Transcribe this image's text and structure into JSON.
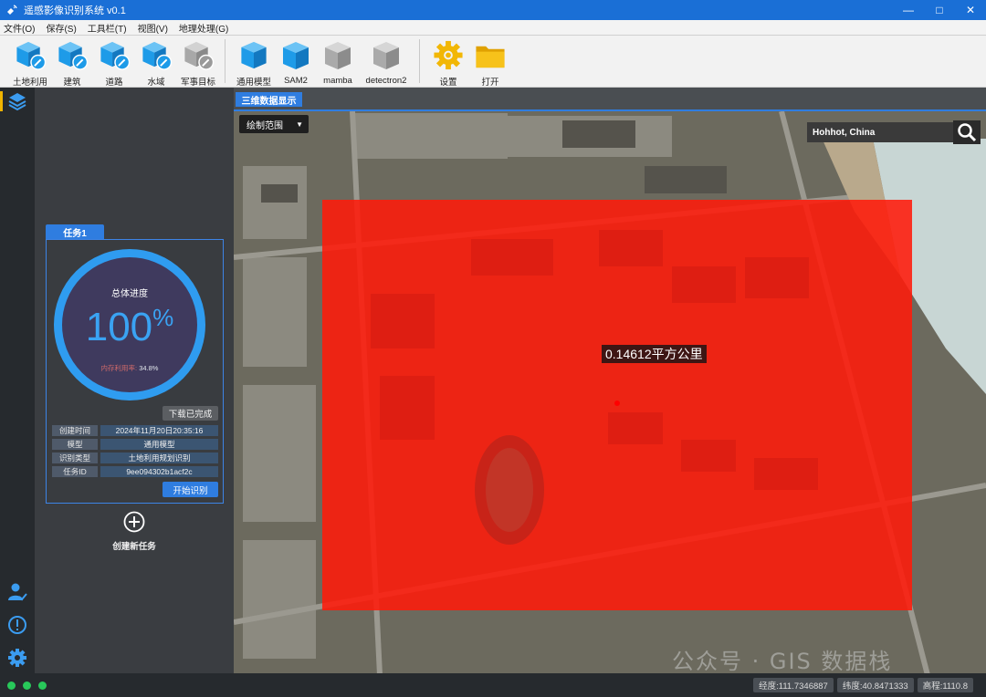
{
  "window": {
    "title": "遥感影像识别系统 v0.1",
    "app_icon": "satellite-icon",
    "controls": [
      "minimize-icon",
      "maximize-icon",
      "close-icon"
    ]
  },
  "menu": [
    "文件(O)",
    "保存(S)",
    "工具栏(T)",
    "视图(V)",
    "地理处理(G)"
  ],
  "toolbar": {
    "group1": [
      {
        "label": "土地利用",
        "icon": "cube-edit-icon",
        "color": "#1e9be8"
      },
      {
        "label": "建筑",
        "icon": "cube-edit-icon",
        "color": "#1e9be8"
      },
      {
        "label": "道路",
        "icon": "cube-edit-icon",
        "color": "#1e9be8"
      },
      {
        "label": "水域",
        "icon": "cube-edit-icon",
        "color": "#1e9be8"
      },
      {
        "label": "军事目标",
        "icon": "cube-edit-icon",
        "color": "#9a9a9a"
      }
    ],
    "group2": [
      {
        "label": "通用模型",
        "icon": "cube-icon",
        "color": "#1e9be8"
      },
      {
        "label": "SAM2",
        "icon": "cube-icon",
        "color": "#1e9be8"
      },
      {
        "label": "mamba",
        "icon": "cube-icon",
        "color": "#9a9a9a"
      },
      {
        "label": "detectron2",
        "icon": "cube-icon",
        "color": "#9a9a9a"
      }
    ],
    "group3": [
      {
        "label": "设置",
        "icon": "gear-icon",
        "color": "#f2b705"
      },
      {
        "label": "打开",
        "icon": "folder-icon",
        "color": "#f2b705"
      }
    ]
  },
  "task": {
    "tab_label": "任务1",
    "progress_title": "总体进度",
    "progress_value": "100",
    "progress_unit": "%",
    "memory_label": "内存利用率:",
    "memory_value": "34.8%",
    "download_button": "下载已完成",
    "info": [
      {
        "key": "创建时间",
        "value": "2024年11月20日20:35:16"
      },
      {
        "key": "模型",
        "value": "通用模型"
      },
      {
        "key": "识别类型",
        "value": "土地利用规划识别"
      },
      {
        "key": "任务ID",
        "value": "9ee094302b1acf2c"
      }
    ],
    "start_button": "开始识别",
    "new_task": "创建新任务"
  },
  "map": {
    "tab_label": "三维数据显示",
    "draw_select": "绘制范围",
    "search_value": "Hohhot, China",
    "area_label": "0.14612平方公里",
    "overlay_color": "#ff1a0a",
    "watermark": "公众号 · GIS 数据栈"
  },
  "status": {
    "longitude": "经度:111.7346887",
    "latitude": "纬度:40.8471333",
    "elevation": "高程:1110.8"
  }
}
